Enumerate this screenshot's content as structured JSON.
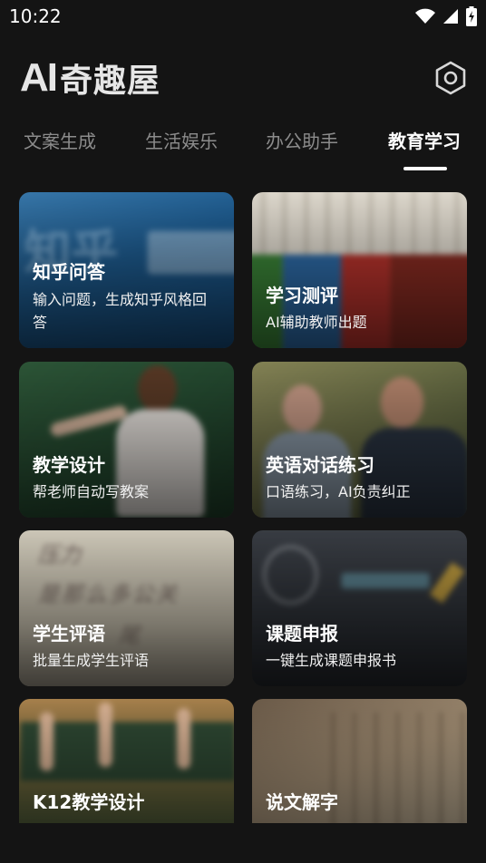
{
  "status": {
    "time": "10:22",
    "icons": [
      "wifi-icon",
      "signal-icon",
      "battery-charging-icon"
    ]
  },
  "app": {
    "logo_ai": "AI",
    "logo_name": "奇趣屋",
    "settings_icon": "settings-hexagon-icon"
  },
  "tabs": [
    {
      "label": "文案生成",
      "active": false
    },
    {
      "label": "生活娱乐",
      "active": false
    },
    {
      "label": "办公助手",
      "active": false
    },
    {
      "label": "教育学习",
      "active": true
    }
  ],
  "cards": [
    {
      "title": "知乎问答",
      "desc": "输入问题，生成知乎风格回答",
      "bg": "zhihu-blue"
    },
    {
      "title": "学习测评",
      "desc": "AI辅助教师出题",
      "bg": "books"
    },
    {
      "title": "教学设计",
      "desc": "帮老师自动写教案",
      "bg": "teacher-chalkboard"
    },
    {
      "title": "英语对话练习",
      "desc": "口语练习，AI负责纠正",
      "bg": "two-men"
    },
    {
      "title": "学生评语",
      "desc": "批量生成学生评语",
      "bg": "handwriting"
    },
    {
      "title": "课题申报",
      "desc": "一键生成课题申报书",
      "bg": "blackboard-bulb"
    },
    {
      "title": "K12教学设计",
      "desc": "",
      "bg": "classroom-hands"
    },
    {
      "title": "说文解字",
      "desc": "",
      "bg": "ancient-book"
    }
  ]
}
